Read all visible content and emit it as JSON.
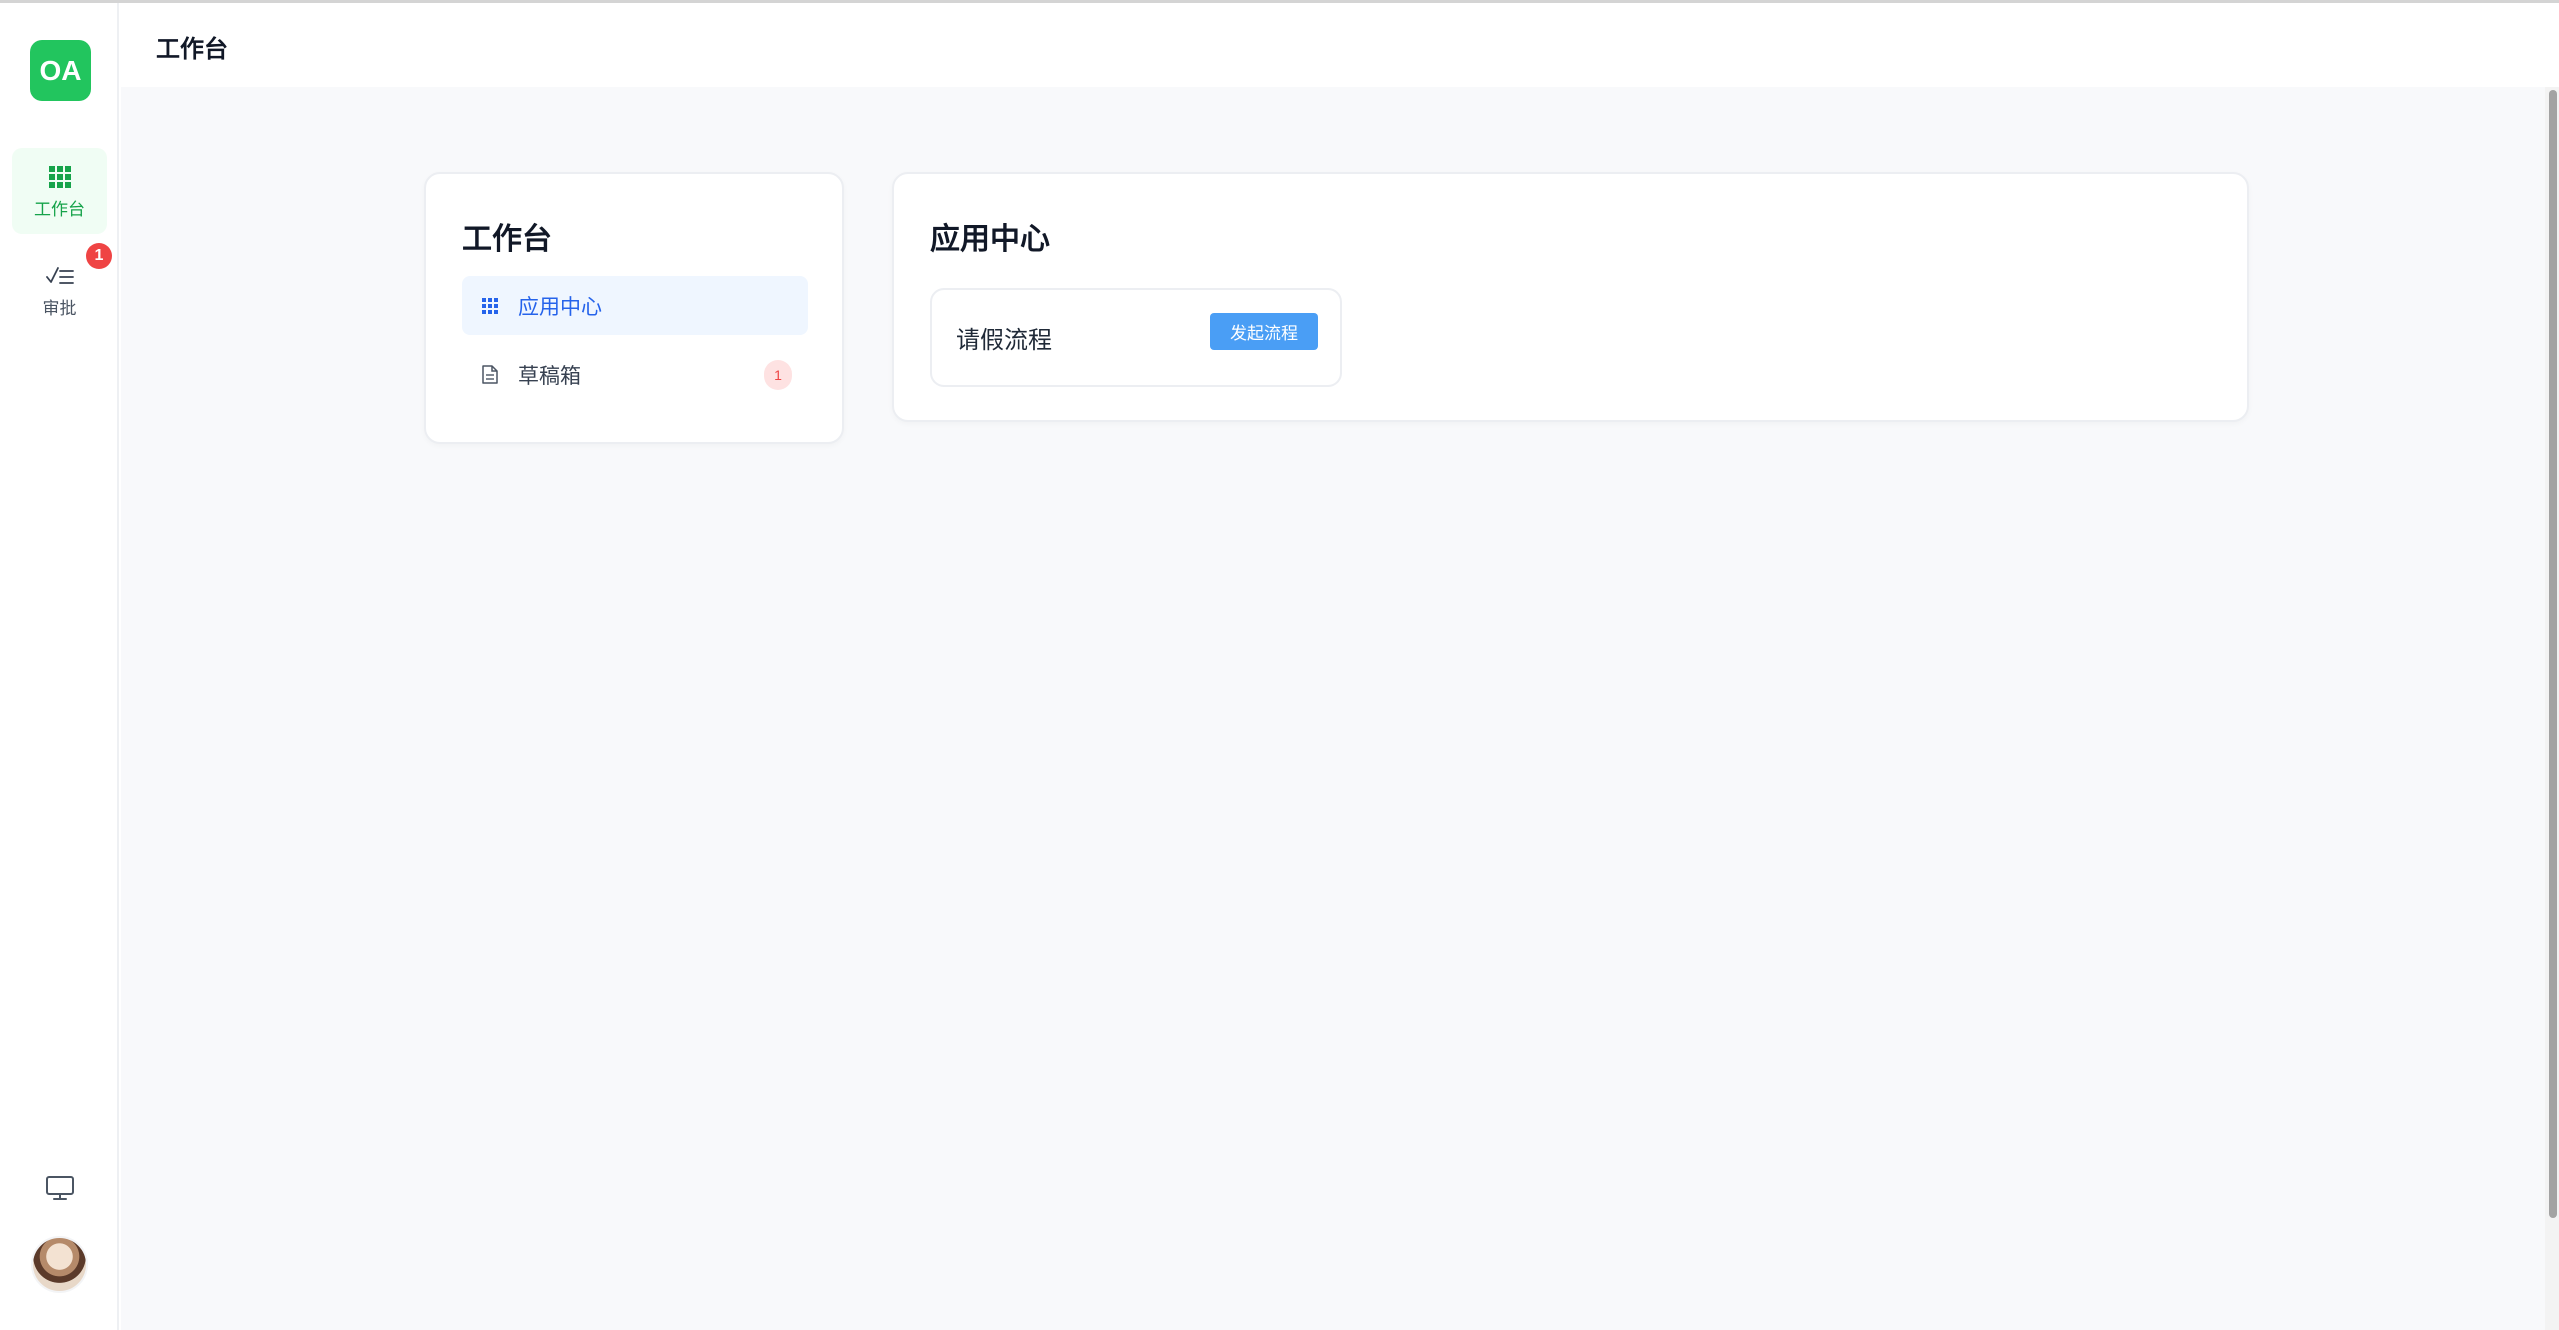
{
  "logo": {
    "text": "OA",
    "color": "#22c55e"
  },
  "sidebar": {
    "items": [
      {
        "label": "工作台",
        "icon": "grid-icon",
        "active": true
      },
      {
        "label": "审批",
        "icon": "checklist-icon",
        "active": false,
        "badge": "1"
      }
    ],
    "bottom": {
      "monitor_icon": "monitor-icon",
      "avatar": "user-avatar"
    }
  },
  "header": {
    "title": "工作台"
  },
  "left_panel": {
    "title": "工作台",
    "menu": [
      {
        "label": "应用中心",
        "icon": "grid-icon",
        "active": true
      },
      {
        "label": "草稿箱",
        "icon": "document-icon",
        "active": false,
        "count": "1"
      }
    ]
  },
  "right_panel": {
    "title": "应用中心",
    "processes": [
      {
        "name": "请假流程",
        "button_label": "发起流程"
      }
    ]
  },
  "colors": {
    "brand_green": "#22c55e",
    "active_blue": "#2563eb",
    "button_blue": "#4a9ef5",
    "badge_red": "#ef4444"
  }
}
